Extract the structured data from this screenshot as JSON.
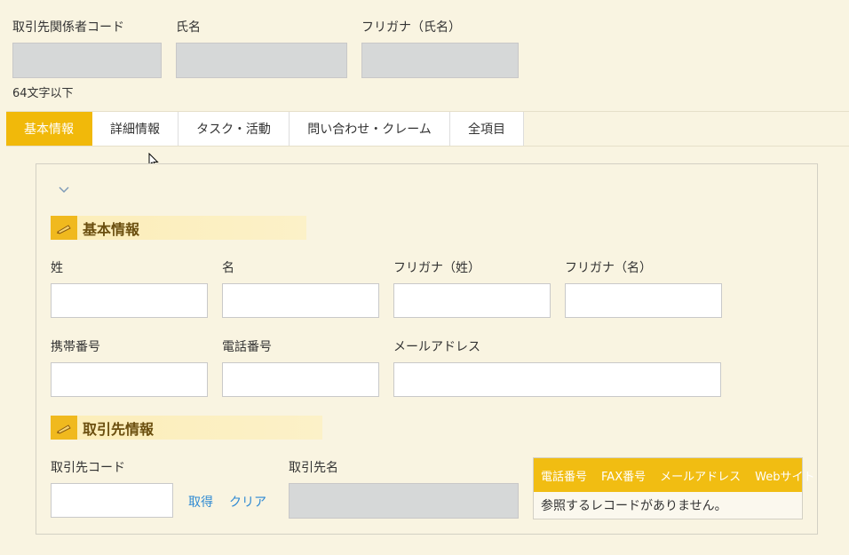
{
  "top": {
    "code_label": "取引先関係者コード",
    "name_label": "氏名",
    "kana_label": "フリガナ（氏名）",
    "code_hint": "64文字以下"
  },
  "tabs": [
    {
      "label": "基本情報",
      "active": true
    },
    {
      "label": "詳細情報",
      "active": false
    },
    {
      "label": "タスク・活動",
      "active": false
    },
    {
      "label": "問い合わせ・クレーム",
      "active": false
    },
    {
      "label": "全項目",
      "active": false
    }
  ],
  "basic": {
    "title": "基本情報",
    "last_name": "姓",
    "first_name": "名",
    "kana_last": "フリガナ（姓）",
    "kana_first": "フリガナ（名）",
    "mobile": "携帯番号",
    "phone": "電話番号",
    "email": "メールアドレス"
  },
  "account": {
    "title": "取引先情報",
    "code_label": "取引先コード",
    "fetch_link": "取得",
    "clear_link": "クリア",
    "name_label": "取引先名"
  },
  "reference": {
    "headers": [
      "電話番号",
      "FAX番号",
      "メールアドレス",
      "Webサイト"
    ],
    "empty_message": "参照するレコードがありません。"
  },
  "icons": {
    "collapse": "chevron-down-icon",
    "section": "pencil-icon",
    "cursor": "mouse-pointer-icon"
  },
  "colors": {
    "background": "#f9f4e1",
    "accent": "#f1b90a",
    "link": "#2f8ad3"
  }
}
